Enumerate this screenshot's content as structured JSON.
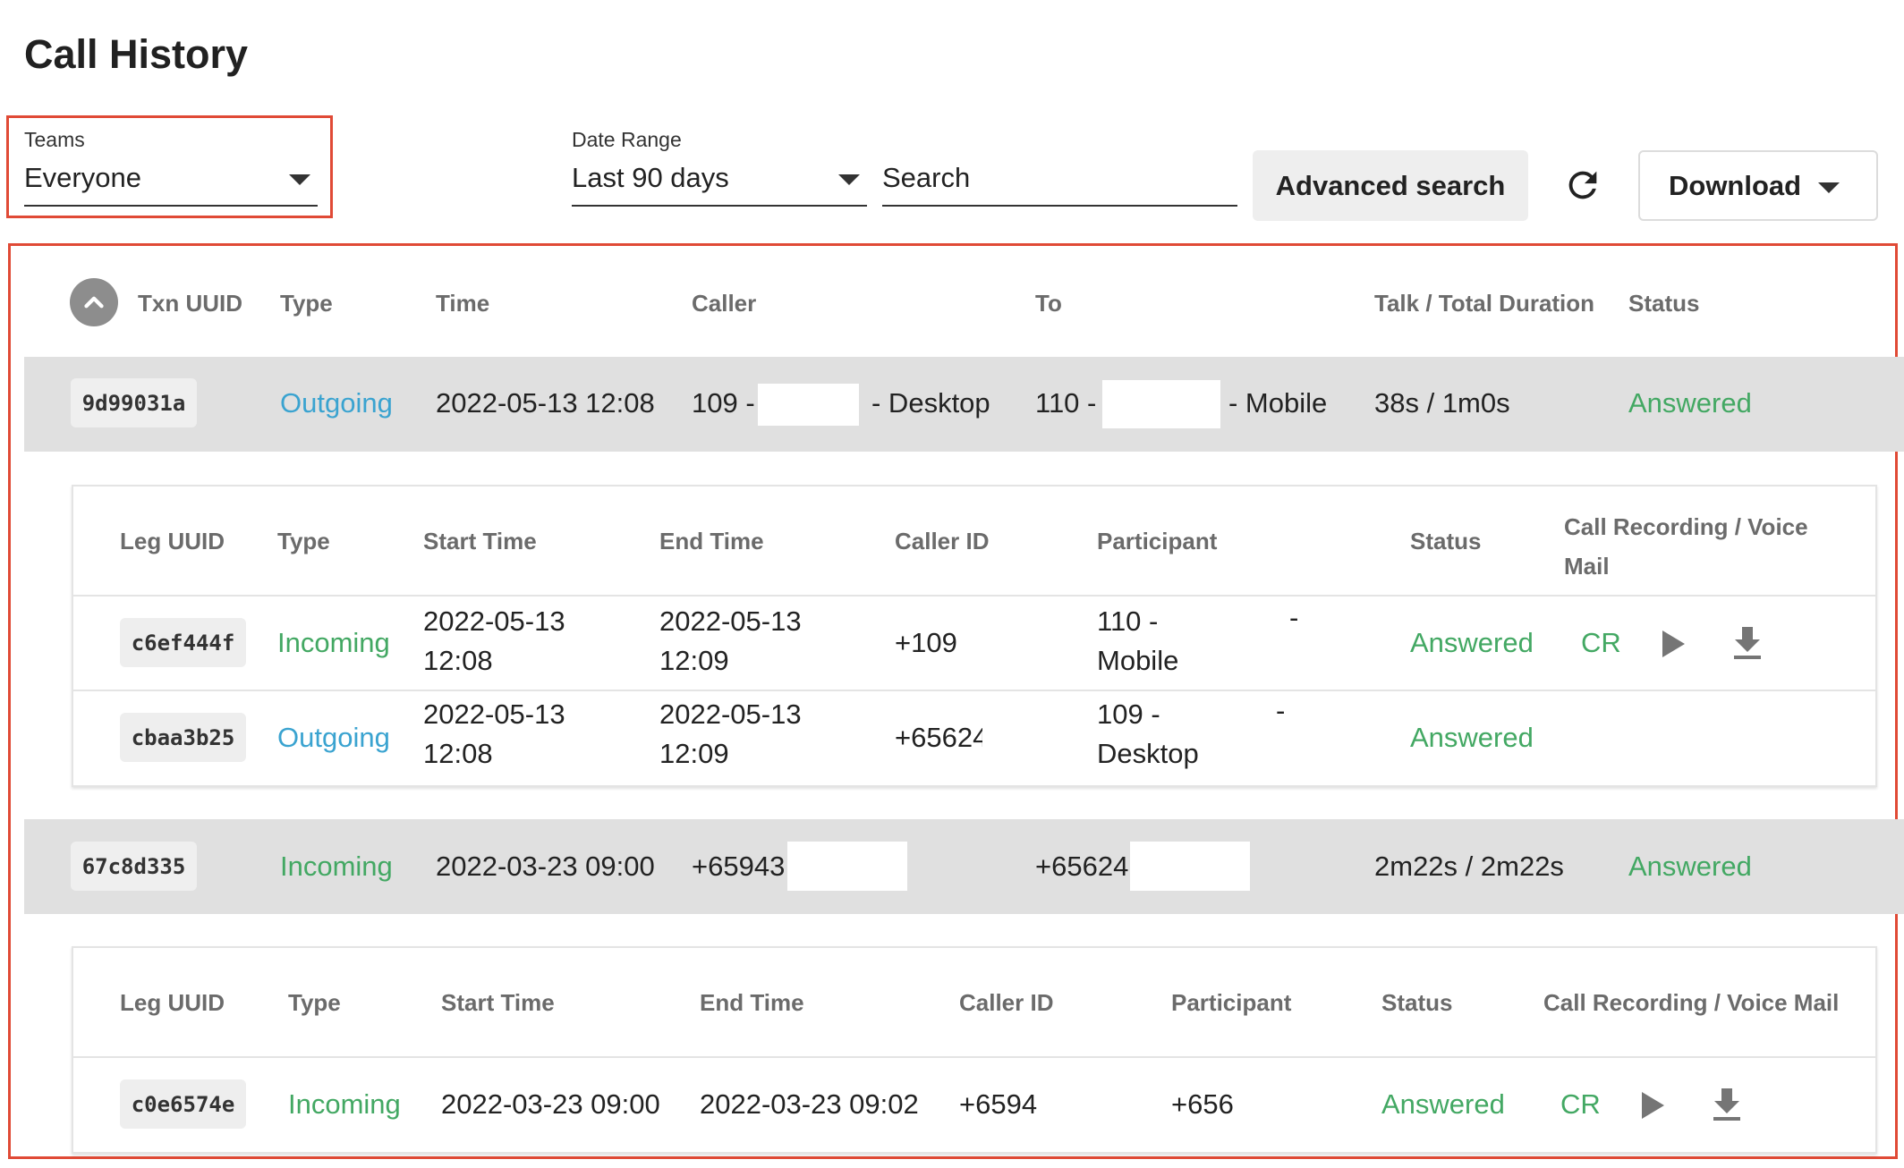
{
  "page": {
    "title": "Call History"
  },
  "filters": {
    "teams": {
      "label": "Teams",
      "value": "Everyone"
    },
    "date_range": {
      "label": "Date Range",
      "value": "Last 90 days"
    },
    "search": {
      "placeholder": "Search"
    },
    "advanced_search_label": "Advanced search",
    "download_label": "Download"
  },
  "table": {
    "headers": [
      "Txn UUID",
      "Type",
      "Time",
      "Caller",
      "To",
      "Talk / Total Duration",
      "Status"
    ],
    "transactions": [
      {
        "uuid": "9d99031a",
        "type": "Outgoing",
        "time": "2022-05-13 12:08",
        "caller_prefix": "109 -",
        "caller_suffix": "- Desktop",
        "to_prefix": "110 -",
        "to_suffix": "- Mobile",
        "duration": "38s / 1m0s",
        "status": "Answered",
        "legs": {
          "headers": [
            "Leg UUID",
            "Type",
            "Start Time",
            "End Time",
            "Caller ID",
            "Participant",
            "Status",
            "Call Recording / Voice Mail"
          ],
          "rows": [
            {
              "uuid": "c6ef444f",
              "type": "Incoming",
              "start_date": "2022-05-13",
              "start_time": "12:08",
              "end_date": "2022-05-13",
              "end_time": "12:09",
              "caller_id": "+109",
              "participant_line1": "110 -",
              "participant_line2": "Mobile",
              "participant_dash": "-",
              "status": "Answered",
              "recording": "CR"
            },
            {
              "uuid": "cbaa3b25",
              "type": "Outgoing",
              "start_date": "2022-05-13",
              "start_time": "12:08",
              "end_date": "2022-05-13",
              "end_time": "12:09",
              "caller_id": "+65624",
              "participant_line1": "109 -",
              "participant_line2": "Desktop",
              "participant_dash": "-",
              "status": "Answered"
            }
          ]
        }
      },
      {
        "uuid": "67c8d335",
        "type": "Incoming",
        "time": "2022-03-23 09:00",
        "caller_prefix": "+65943",
        "to_prefix": "+65624",
        "duration": "2m22s / 2m22s",
        "status": "Answered",
        "legs": {
          "headers": [
            "Leg UUID",
            "Type",
            "Start Time",
            "End Time",
            "Caller ID",
            "Participant",
            "Status",
            "Call Recording / Voice Mail"
          ],
          "rows": [
            {
              "uuid": "c0e6574e",
              "type": "Incoming",
              "start": "2022-03-23 09:00",
              "end": "2022-03-23 09:02",
              "caller_id": "+6594",
              "participant": "+656",
              "status": "Answered",
              "recording": "CR"
            }
          ]
        }
      }
    ]
  },
  "colors": {
    "outgoing": "#3aa3d0",
    "incoming_answered": "#43a863",
    "highlight": "#e04a36"
  },
  "icons": [
    "dropdown-caret-icon",
    "refresh-icon",
    "collapse-chevron-icon",
    "play-icon",
    "download-icon"
  ]
}
